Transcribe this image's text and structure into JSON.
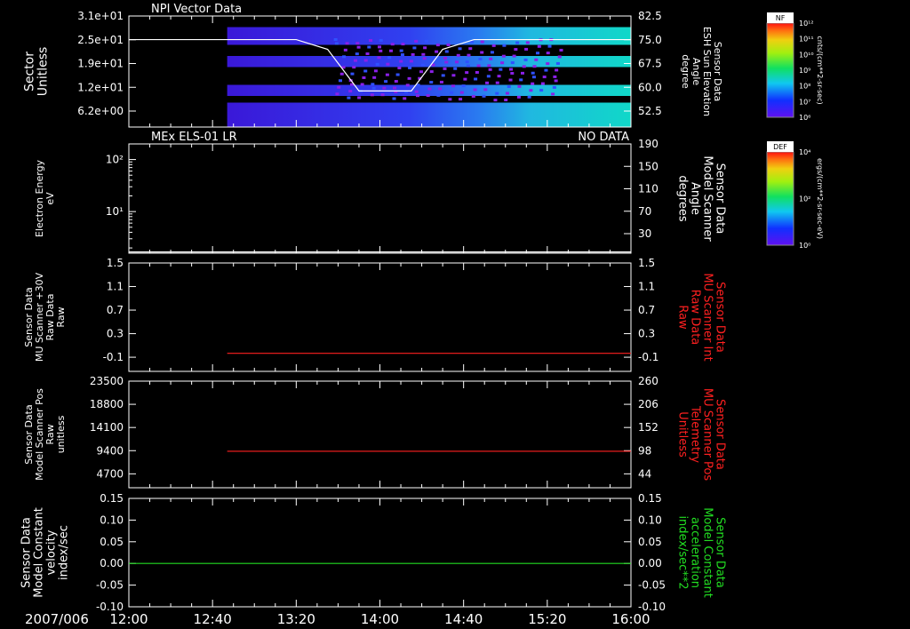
{
  "colors": {
    "background": "#000000",
    "axis": "#ffffff",
    "red_series": "#ff2020",
    "green_series": "#22dd22",
    "white_series": "#ffffff"
  },
  "time_axis": {
    "date": "2007/006",
    "ticks": [
      "12:00",
      "12:40",
      "13:20",
      "14:00",
      "14:40",
      "15:20",
      "16:00"
    ]
  },
  "colorbars": [
    {
      "name": "NF",
      "unit": "cnts/(cm**2-sr-sec)",
      "ticks": [
        "10¹²",
        "10¹¹",
        "10¹⁰",
        "10⁹",
        "10⁸",
        "10⁷",
        "10⁶"
      ]
    },
    {
      "name": "DEF",
      "unit": "ergs/(cm**2-sr-sec-eV)",
      "ticks": [
        "10⁴",
        "10²",
        "10⁰"
      ]
    }
  ],
  "chart_data": [
    {
      "type": "heatmap",
      "title": "NPI Vector Data",
      "ylabel": [
        "Sector",
        "Unitless"
      ],
      "yticks": [
        "3.1e+01",
        "2.5e+01",
        "1.9e+01",
        "1.2e+01",
        "6.2e+00"
      ],
      "right_label": [
        "Sensor Data",
        "ESH Sun Elevation",
        "Angle",
        "degree"
      ],
      "right_ticks": [
        "82.5",
        "75.0",
        "67.5",
        "60.0",
        "52.5"
      ],
      "right_ylim": [
        45,
        85
      ],
      "overlay_series": {
        "name": "ESH Sun Elevation Angle",
        "x": [
          "12:00",
          "13:20",
          "13:35",
          "13:50",
          "14:15",
          "14:30",
          "14:45",
          "16:00"
        ],
        "y": [
          76.5,
          76.5,
          73,
          58,
          58,
          73,
          76.5,
          76.5
        ]
      }
    },
    {
      "type": "line",
      "title": "MEx ELS-01 LR",
      "status": "NO DATA",
      "ylabel": [
        "Electron Energy",
        "eV"
      ],
      "yticks": [
        "10²",
        "10¹"
      ],
      "ylim_log": [
        0.2,
        2.3
      ],
      "right_label": [
        "Sensor Data",
        "Model Scanner",
        "Angle",
        "degrees"
      ],
      "right_ticks": [
        "190",
        "150",
        "110",
        "70",
        "30"
      ],
      "right_ylim": [
        10,
        190
      ],
      "series": [
        {
          "x": [
            "12:00",
            "16:00"
          ],
          "y": [
            12,
            12
          ]
        }
      ]
    },
    {
      "type": "line",
      "ylabel": [
        "Sensor Data",
        "MU Scanner +30V",
        "Raw Data",
        "Raw"
      ],
      "yticks": [
        "1.5",
        "1.1",
        "0.7",
        "0.3",
        "-0.1"
      ],
      "ylim": [
        -0.3,
        1.5
      ],
      "right_label": [
        "Sensor Data",
        "MU Scanner Int",
        "Raw Data",
        "Raw"
      ],
      "right_ticks": [
        "1.5",
        "1.1",
        "0.7",
        "0.3",
        "-0.1"
      ],
      "right_ylim": [
        -0.3,
        1.5
      ],
      "series": [
        {
          "x": [
            "12:47",
            "16:00"
          ],
          "y": [
            0.0,
            0.0
          ],
          "axis": "right"
        }
      ]
    },
    {
      "type": "line",
      "ylabel": [
        "Sensor Data",
        "Model Scanner Pos",
        "Raw",
        "unitless"
      ],
      "yticks": [
        "23500",
        "18800",
        "14100",
        "9400",
        "4700"
      ],
      "ylim": [
        0,
        23500
      ],
      "right_label": [
        "Sensor Data",
        "MU Scanner Pos",
        "Telemetry",
        "Unitless"
      ],
      "right_ticks": [
        "260",
        "206",
        "152",
        "98",
        "44"
      ],
      "right_ylim": [
        0,
        260
      ],
      "series": [
        {
          "x": [
            "12:47",
            "16:00"
          ],
          "y": [
            89,
            89
          ],
          "axis": "right"
        }
      ]
    },
    {
      "type": "line",
      "ylabel": [
        "Sensor Data",
        "Model Constant",
        "velocity",
        "index/sec"
      ],
      "yticks": [
        "0.15",
        "0.10",
        "0.05",
        "0.00",
        "-0.05",
        "-0.10"
      ],
      "ylim": [
        -0.1,
        0.15
      ],
      "right_label": [
        "Sensor Data",
        "Model Constant",
        "acceleration",
        "index/sec**2"
      ],
      "right_ticks": [
        "0.15",
        "0.10",
        "0.05",
        "0.00",
        "-0.05",
        "-0.10"
      ],
      "right_ylim": [
        -0.1,
        0.15
      ],
      "series": [
        {
          "x": [
            "12:00",
            "16:00"
          ],
          "y": [
            0.0,
            0.0
          ],
          "axis": "right"
        }
      ]
    }
  ]
}
